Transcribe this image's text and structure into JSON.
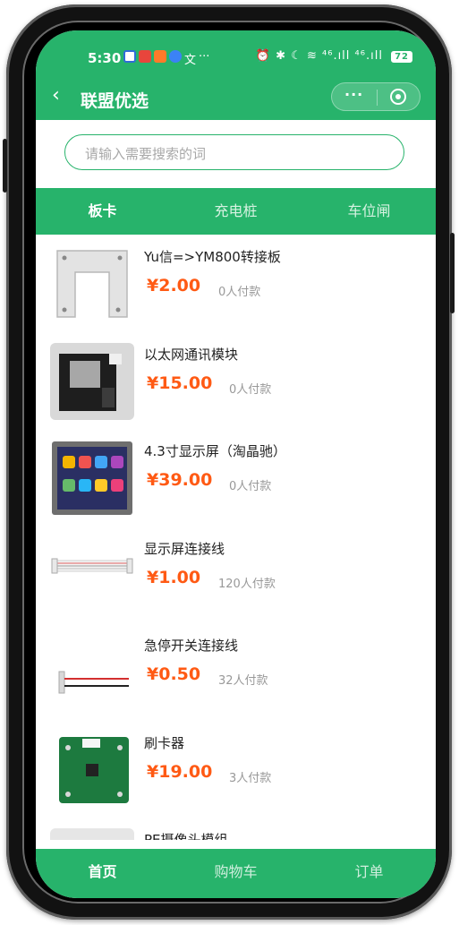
{
  "status_bar": {
    "time": "5:30",
    "app_icons": [
      "gallery-app-icon",
      "mail-app-icon",
      "store-app-icon",
      "browser-app-icon",
      "translate-app-icon"
    ],
    "more": "···",
    "right_text": "⏰ ✱ ☾ ≋ ⁴⁶.ıll ⁴⁶.ıll",
    "battery": "72"
  },
  "navbar": {
    "back": "‹",
    "title": "联盟优选",
    "more": "···"
  },
  "search": {
    "placeholder": "请输入需要搜索的词"
  },
  "tabs": [
    {
      "label": "板卡",
      "active": true
    },
    {
      "label": "充电桩",
      "active": false
    },
    {
      "label": "车位闸",
      "active": false
    }
  ],
  "products": [
    {
      "name": "Yu信=>YM800转接板",
      "price": "¥2.00",
      "paid": "0人付款"
    },
    {
      "name": "以太网通讯模块",
      "price": "¥15.00",
      "paid": "0人付款"
    },
    {
      "name": "4.3寸显示屏（淘晶驰）",
      "price": "¥39.00",
      "paid": "0人付款"
    },
    {
      "name": "显示屏连接线",
      "price": "¥1.00",
      "paid": "120人付款"
    },
    {
      "name": "急停开关连接线",
      "price": "¥0.50",
      "paid": "32人付款"
    },
    {
      "name": "刷卡器",
      "price": "¥19.00",
      "paid": "3人付款"
    },
    {
      "name": "PE摄像头模组",
      "price": "",
      "paid": ""
    }
  ],
  "bottom_nav": [
    {
      "label": "首页",
      "active": true
    },
    {
      "label": "购物车",
      "active": false
    },
    {
      "label": "订单",
      "active": false
    }
  ],
  "colors": {
    "brand_green": "#27b36b",
    "price_orange": "#ff5a14"
  }
}
